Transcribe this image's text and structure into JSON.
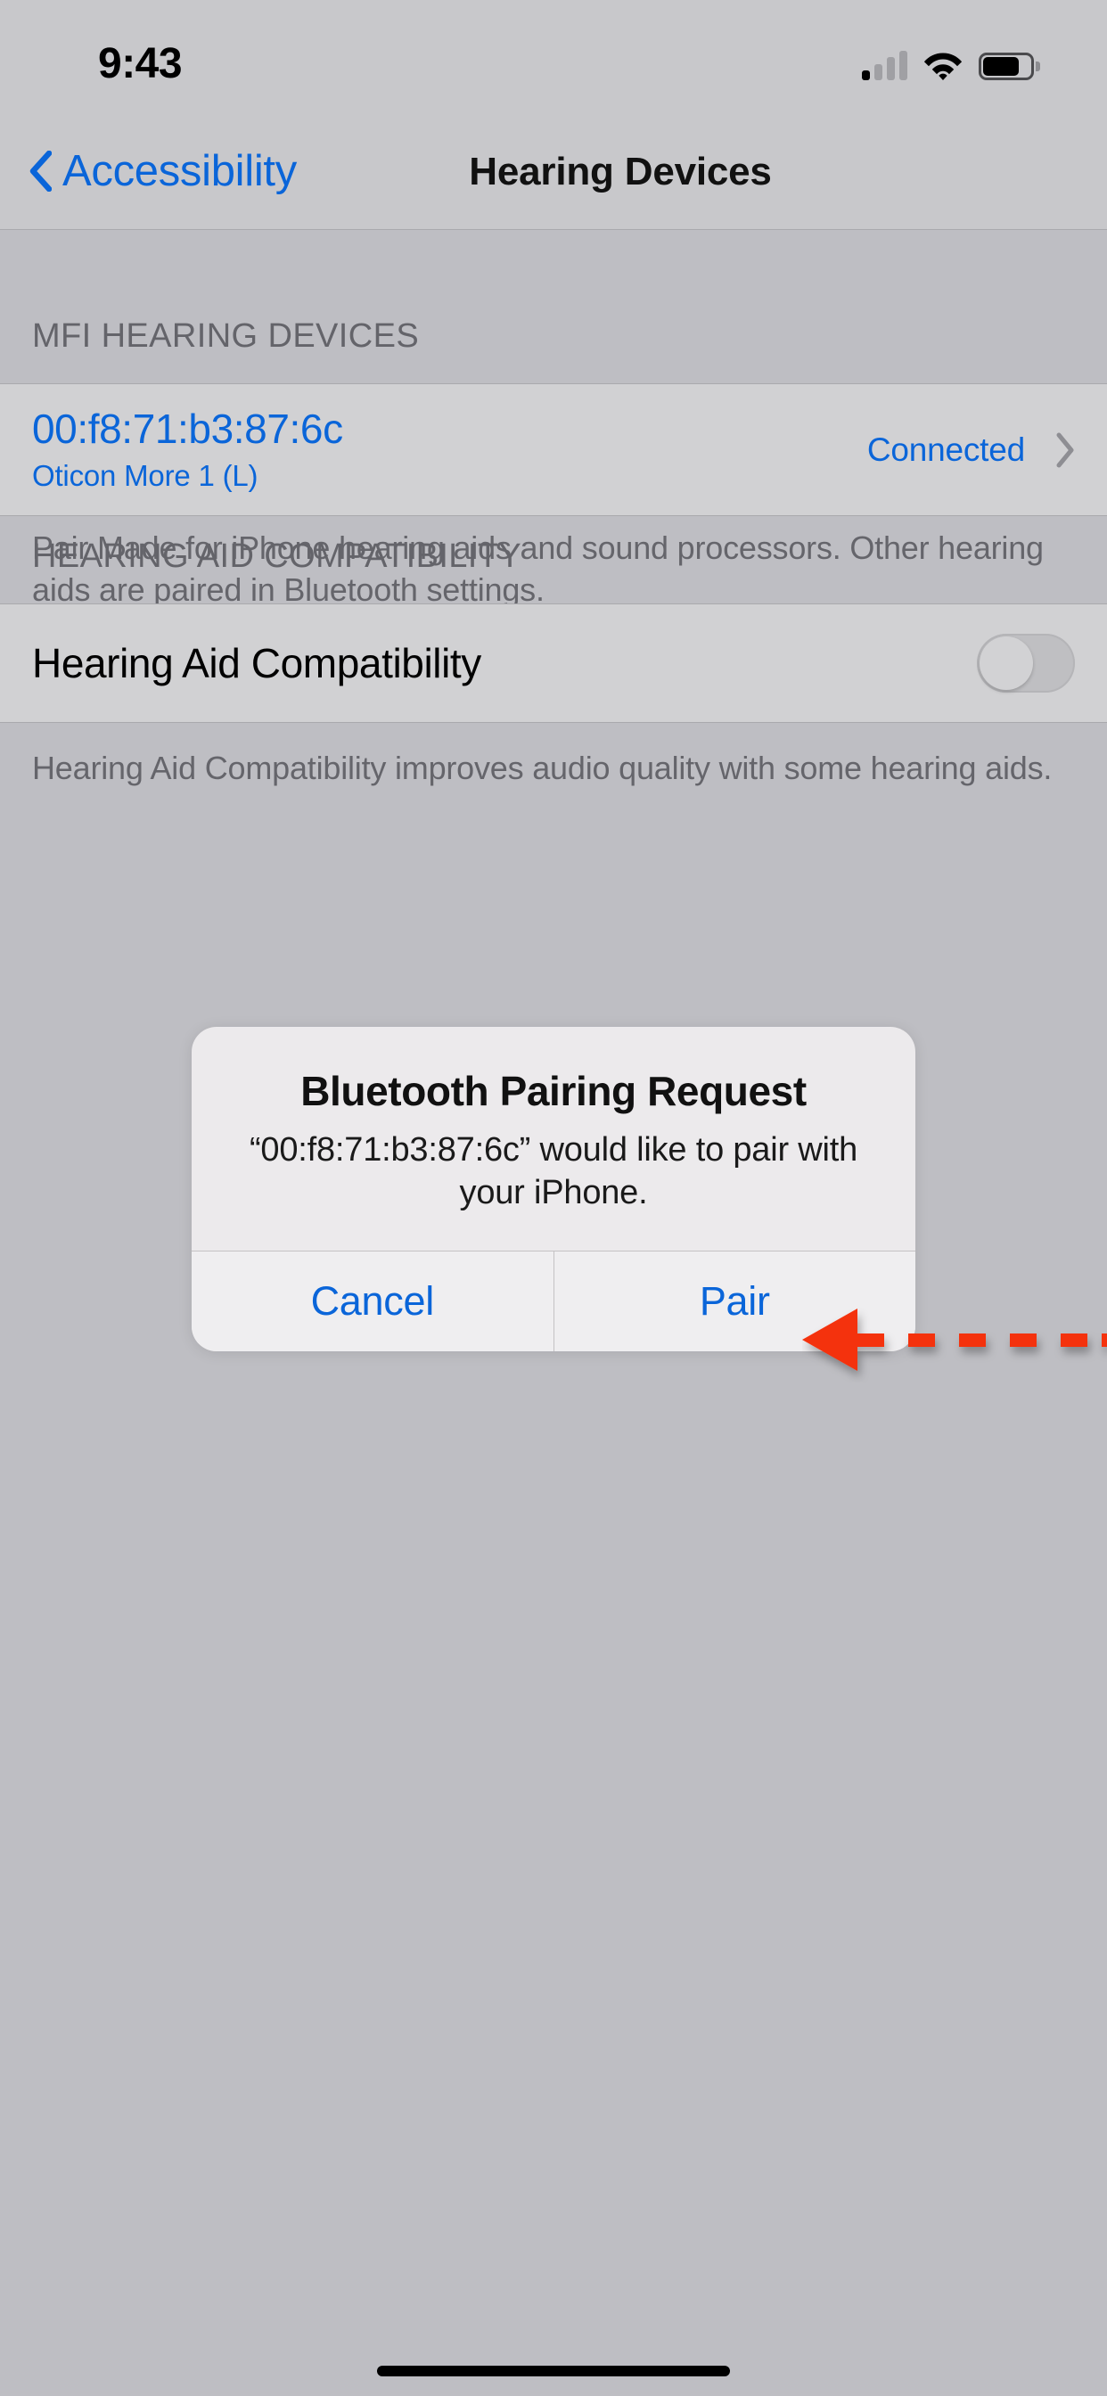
{
  "status_bar": {
    "time": "9:43",
    "signal_icon": "cellular-signal-icon",
    "signal_bars_filled": 1,
    "signal_bars_total": 4,
    "wifi_icon": "wifi-icon",
    "battery_icon": "battery-icon",
    "battery_level_percent": 72
  },
  "nav": {
    "back_label": "Accessibility",
    "back_icon": "chevron-left-icon",
    "title": "Hearing Devices"
  },
  "sections": [
    {
      "header": "MFI HEARING DEVICES",
      "footer": "Pair Made for iPhone hearing aids and sound processors. Other hearing aids are paired in Bluetooth settings."
    },
    {
      "header": "HEARING AID COMPATIBILITY",
      "footer": "Hearing Aid Compatibility improves audio quality with some hearing aids."
    }
  ],
  "device": {
    "mac_address": "00:f8:71:b3:87:6c",
    "model_name": "Oticon More 1 (L)",
    "status": "Connected",
    "disclosure_icon": "chevron-right-icon"
  },
  "hearing_aid_compatibility": {
    "label": "Hearing Aid Compatibility",
    "state": "off"
  },
  "alert": {
    "title": "Bluetooth Pairing Request",
    "message": "“00:f8:71:b3:87:6c” would like to pair with your iPhone.",
    "cancel_label": "Cancel",
    "confirm_label": "Pair"
  },
  "annotation": {
    "icon": "left-arrow-annotation-icon",
    "points_to": "Pair",
    "color": "#F4330D"
  },
  "colors": {
    "tint_blue": "#0a65d9",
    "group_background": "#bebec3",
    "cell_background": "#d1d1d3",
    "bar_background": "#c8c8cb",
    "footer_text": "#65656b",
    "alert_background": "#eceaec",
    "annotation_red": "#F4330D"
  },
  "home_indicator": "home-indicator"
}
